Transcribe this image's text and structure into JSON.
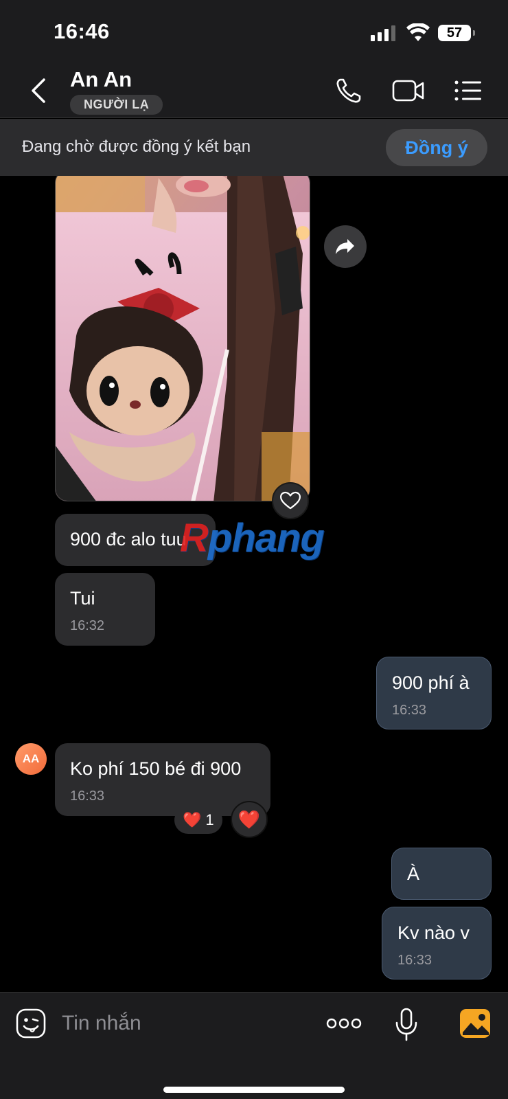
{
  "status_bar": {
    "time": "16:46",
    "battery": "57"
  },
  "header": {
    "contact_name": "An An",
    "badge": "NGƯỜI LẠ"
  },
  "friend_request": {
    "text": "Đang chờ được đồng ý kết bạn",
    "accept_label": "Đồng ý"
  },
  "messages": [
    {
      "text": "900 đc alo tuu",
      "time": ""
    },
    {
      "text": "Tui",
      "time": "16:32"
    },
    {
      "text": "900 phí à",
      "time": "16:33"
    },
    {
      "text": "Ko phí 150 bé đi 900",
      "time": "16:33"
    },
    {
      "text": "À",
      "time": ""
    },
    {
      "text": "Kv nào v",
      "time": "16:33"
    }
  ],
  "avatar_initials": "AA",
  "reaction": {
    "emoji": "❤️",
    "count": "1"
  },
  "watermark": {
    "first": "R",
    "rest": "phang"
  },
  "input": {
    "placeholder": "Tin nhắn"
  },
  "icons": {
    "back": "chevron-left-icon",
    "call": "phone-icon",
    "video": "video-camera-icon",
    "menu": "list-icon",
    "forward": "share-icon",
    "like": "heart-outline-icon",
    "sticker": "sticker-icon",
    "more": "more-dots-icon",
    "mic": "microphone-icon",
    "gallery": "image-icon"
  },
  "colors": {
    "accent": "#3b9cff",
    "outgoing_bubble": "#2f3a48",
    "incoming_bubble": "#2c2c2e",
    "gallery_icon": "#f5a623"
  }
}
